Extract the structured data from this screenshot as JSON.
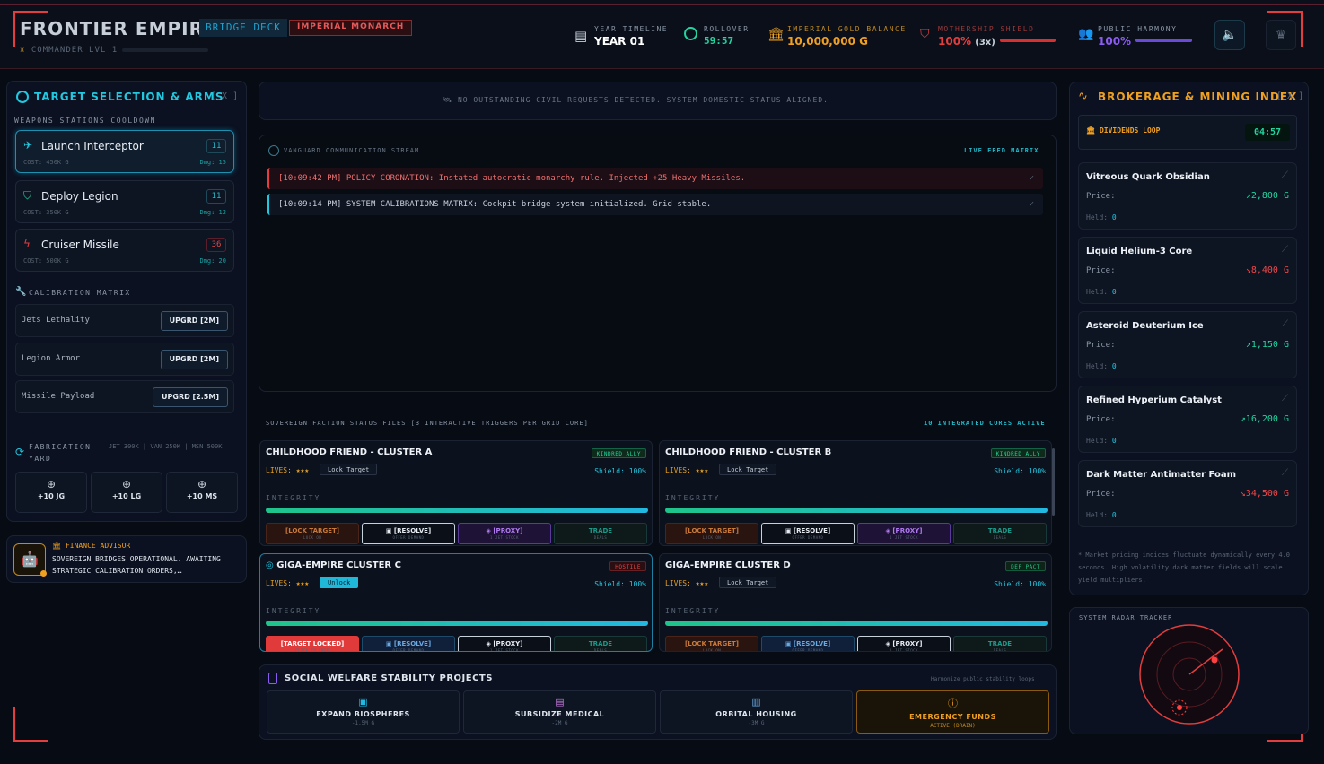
{
  "header": {
    "brand": "FRONTIER EMPIRE",
    "deck_tag": "BRIDGE DECK",
    "monarch_tag": "IMPERIAL MONARCH",
    "commander": "COMMANDER LVL 1",
    "commander_progress": 0.0,
    "timeline_label": "YEAR TIMELINE",
    "timeline_value": "YEAR 01",
    "rollover_label": "ROLLOVER",
    "rollover_value": "59:57",
    "gold_label": "IMPERIAL GOLD BALANCE",
    "gold_value": "10,000,000 G",
    "shield_label": "MOTHERSHIP SHIELD",
    "shield_value": "100%",
    "shield_mult": "(3x)",
    "shield_level": 1.0,
    "harmony_label": "PUBLIC HARMONY",
    "harmony_value": "100%",
    "harmony_level": 1.0
  },
  "colors": {
    "accent": "#22c7e0",
    "danger": "#e43d3d",
    "gold": "#f0a020",
    "purple": "#8a5cf0",
    "green": "#22d4a0"
  },
  "left": {
    "title": "TARGET SELECTION & ARMS",
    "close": "[ X ]",
    "weapons_section": "WEAPONS STATIONS COOLDOWN",
    "weapons": [
      {
        "name": "Launch Interceptor",
        "cost": "COST: 450K G",
        "dmg": "Dmg: 15",
        "cooldown": "11"
      },
      {
        "name": "Deploy Legion",
        "cost": "COST: 350K G",
        "dmg": "Dmg: 12",
        "cooldown": "11"
      },
      {
        "name": "Cruiser Missile",
        "cost": "COST: 500K G",
        "dmg": "Dmg: 20",
        "cooldown": "36"
      }
    ],
    "calib_section": "CALIBRATION MATRIX",
    "upgrades": [
      {
        "name": "Jets Lethality",
        "btn": "UPGRD [2M]"
      },
      {
        "name": "Legion Armor",
        "btn": "UPGRD [2M]"
      },
      {
        "name": "Missile Payload",
        "btn": "UPGRD [2.5M]"
      }
    ],
    "fab_title": "FABRICATION YARD",
    "fab_costs": "JET 300K | VAN 250K | MSN 500K",
    "fab": [
      "+10 JG",
      "+10 LG",
      "+10 MS"
    ],
    "advisor_title": "FINANCE ADVISOR",
    "advisor_text": "SOVEREIGN BRIDGES OPERATIONAL. AWAITING STRATEGIC CALIBRATION ORDERS,…"
  },
  "center": {
    "notice": "NO OUTSTANDING CIVIL REQUESTS DETECTED. SYSTEM DOMESTIC STATUS ALIGNED.",
    "stream_title": "VANGUARD COMMUNICATION STREAM",
    "stream_badge": "LIVE FEED MATRIX",
    "logs": [
      {
        "text": "[10:09:42 PM] POLICY CORONATION: Instated autocratic monarchy rule. Injected +25 Heavy Missiles.",
        "check": "✓"
      },
      {
        "text": "[10:09:14 PM] SYSTEM CALIBRATIONS MATRIX: Cockpit bridge system initialized. Grid stable.",
        "check": "✓"
      }
    ],
    "faction_title": "SOVEREIGN FACTION STATUS FILES [3 INTERACTIVE TRIGGERS PER GRID CORE]",
    "faction_count": "10 INTEGRATED CORES ACTIVE",
    "lives_label": "LIVES:",
    "shield_label": "Shield:",
    "integrity_label": "INTEGRITY",
    "cores": [
      {
        "name": "CHILDHOOD FRIEND - CLUSTER A",
        "tag": "KINDRED ALLY",
        "lives": "★★★",
        "lock": "Lock Target",
        "shield": "100%",
        "integrity": 1.0,
        "actions": [
          [
            "[LOCK TARGET]",
            "LOCK ON"
          ],
          [
            "[RESOLVE]",
            "OFFER DEMAND"
          ],
          [
            "[PROXY]",
            "1 JET STOCK"
          ],
          [
            "TRADE",
            "DEALS"
          ]
        ]
      },
      {
        "name": "CHILDHOOD FRIEND - CLUSTER B",
        "tag": "KINDRED ALLY",
        "lives": "★★★",
        "lock": "Lock Target",
        "shield": "100%",
        "integrity": 1.0,
        "actions": [
          [
            "[LOCK TARGET]",
            "LOCK ON"
          ],
          [
            "[RESOLVE]",
            "OFFER DEMAND"
          ],
          [
            "[PROXY]",
            "1 JET STOCK"
          ],
          [
            "TRADE",
            "DEALS"
          ]
        ]
      },
      {
        "name": "GIGA-EMPIRE CLUSTER C",
        "tag": "HOSTILE",
        "lives": "★★★",
        "lock": "Unlock",
        "shield": "100%",
        "integrity": 1.0,
        "actions": [
          [
            "[TARGET LOCKED]",
            "CLICK TO FREE"
          ],
          [
            "[RESOLVE]",
            "OFFER DEMAND"
          ],
          [
            "[PROXY]",
            "1 JET STOCK"
          ],
          [
            "TRADE",
            "DEALS"
          ]
        ]
      },
      {
        "name": "GIGA-EMPIRE CLUSTER D",
        "tag": "DEF PACT",
        "lives": "★★★",
        "lock": "Lock Target",
        "shield": "100%",
        "integrity": 1.0,
        "actions": [
          [
            "[LOCK TARGET]",
            "LOCK ON"
          ],
          [
            "[RESOLVE]",
            "OFFER DEMAND"
          ],
          [
            "[PROXY]",
            "1 JET STOCK"
          ],
          [
            "TRADE",
            "DEALS"
          ]
        ]
      }
    ],
    "welfare_title": "SOCIAL WELFARE STABILITY PROJECTS",
    "welfare_hint": "Harmonize public stability loops",
    "welfare": [
      {
        "label": "EXPAND BIOSPHERES",
        "cost": "-1.5M G"
      },
      {
        "label": "SUBSIDIZE MEDICAL",
        "cost": "-2M G"
      },
      {
        "label": "ORBITAL HOUSING",
        "cost": "-3M G"
      },
      {
        "label": "EMERGENCY FUNDS",
        "cost": "ACTIVE (DRAIN)"
      }
    ]
  },
  "right": {
    "title": "BROKERAGE & MINING INDEX",
    "close": "[ X ]",
    "dividends_label": "DIVIDENDS LOOP",
    "dividends_value": "04:57",
    "price_label": "Price:",
    "held_label": "Held:",
    "assets": [
      {
        "name": "Vitreous Quark Obsidian",
        "price": "2,800 G",
        "trend": "up",
        "held": "0"
      },
      {
        "name": "Liquid Helium-3 Core",
        "price": "8,400 G",
        "trend": "down",
        "held": "0"
      },
      {
        "name": "Asteroid Deuterium Ice",
        "price": "1,150 G",
        "trend": "up",
        "held": "0"
      },
      {
        "name": "Refined Hyperium Catalyst",
        "price": "16,200 G",
        "trend": "up",
        "held": "0"
      },
      {
        "name": "Dark Matter Antimatter Foam",
        "price": "34,500 G",
        "trend": "down",
        "held": "0"
      }
    ],
    "note": "* Market pricing indices fluctuate dynamically every 4.0 seconds. High volatility dark matter fields will scale yield multipliers.",
    "radar_title": "SYSTEM RADAR TRACKER"
  }
}
